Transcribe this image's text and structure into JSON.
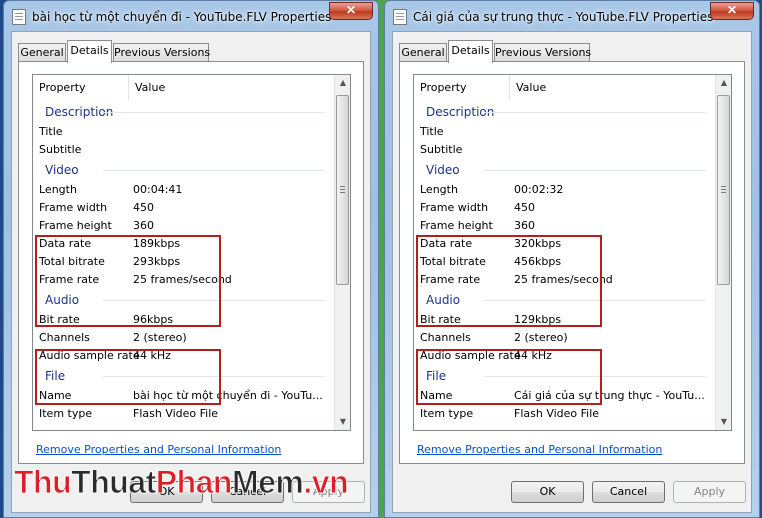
{
  "windows": [
    {
      "title": "bài học từ một chuyển đi - YouTube.FLV Properties",
      "tabs": {
        "general": "General",
        "details": "Details",
        "previous_versions": "Previous Versions"
      },
      "columns": {
        "property": "Property",
        "value": "Value"
      },
      "sections": {
        "description": "Description",
        "video": "Video",
        "audio": "Audio",
        "file": "File"
      },
      "rows": {
        "title": {
          "p": "Title",
          "v": ""
        },
        "subtitle": {
          "p": "Subtitle",
          "v": ""
        },
        "length": {
          "p": "Length",
          "v": "00:04:41"
        },
        "frame_width": {
          "p": "Frame width",
          "v": "450"
        },
        "frame_height": {
          "p": "Frame height",
          "v": "360"
        },
        "data_rate": {
          "p": "Data rate",
          "v": "189kbps"
        },
        "total_bitrate": {
          "p": "Total bitrate",
          "v": "293kbps"
        },
        "frame_rate": {
          "p": "Frame rate",
          "v": "25 frames/second"
        },
        "bit_rate": {
          "p": "Bit rate",
          "v": "96kbps"
        },
        "channels": {
          "p": "Channels",
          "v": "2 (stereo)"
        },
        "sample_rate": {
          "p": "Audio sample rate",
          "v": "44 kHz"
        },
        "name": {
          "p": "Name",
          "v": "bài học từ một chuyển đi - YouTu..."
        },
        "item_type": {
          "p": "Item type",
          "v": "Flash Video File"
        }
      },
      "link": "Remove Properties and Personal Information",
      "buttons": {
        "ok": "OK",
        "cancel": "Cancel",
        "apply": "Apply"
      }
    },
    {
      "title": "Cái giá của sự trung thực - YouTube.FLV Properties",
      "tabs": {
        "general": "General",
        "details": "Details",
        "previous_versions": "Previous Versions"
      },
      "columns": {
        "property": "Property",
        "value": "Value"
      },
      "sections": {
        "description": "Description",
        "video": "Video",
        "audio": "Audio",
        "file": "File"
      },
      "rows": {
        "title": {
          "p": "Title",
          "v": ""
        },
        "subtitle": {
          "p": "Subtitle",
          "v": ""
        },
        "length": {
          "p": "Length",
          "v": "00:02:32"
        },
        "frame_width": {
          "p": "Frame width",
          "v": "450"
        },
        "frame_height": {
          "p": "Frame height",
          "v": "360"
        },
        "data_rate": {
          "p": "Data rate",
          "v": "320kbps"
        },
        "total_bitrate": {
          "p": "Total bitrate",
          "v": "456kbps"
        },
        "frame_rate": {
          "p": "Frame rate",
          "v": "25 frames/second"
        },
        "bit_rate": {
          "p": "Bit rate",
          "v": "129kbps"
        },
        "channels": {
          "p": "Channels",
          "v": "2 (stereo)"
        },
        "sample_rate": {
          "p": "Audio sample rate",
          "v": "44 kHz"
        },
        "name": {
          "p": "Name",
          "v": "Cái giá của sự trung thực - YouTu..."
        },
        "item_type": {
          "p": "Item type",
          "v": "Flash Video File"
        }
      },
      "link": "Remove Properties and Personal Information",
      "buttons": {
        "ok": "OK",
        "cancel": "Cancel",
        "apply": "Apply"
      }
    }
  ],
  "watermark": {
    "part1": "Thu",
    "part2": "Thuat",
    "part3": "Phan",
    "part4": "Mem",
    "part5": ".vn"
  },
  "colors": {
    "highlight_box": "#b31e23",
    "section_heading": "#1e3287",
    "link": "#0052cc",
    "watermark_red": "#dc1f26"
  },
  "icons": {
    "title_icon": "document-icon",
    "close": "close-icon",
    "scroll_up": "chevron-up-icon",
    "scroll_down": "chevron-down-icon"
  }
}
